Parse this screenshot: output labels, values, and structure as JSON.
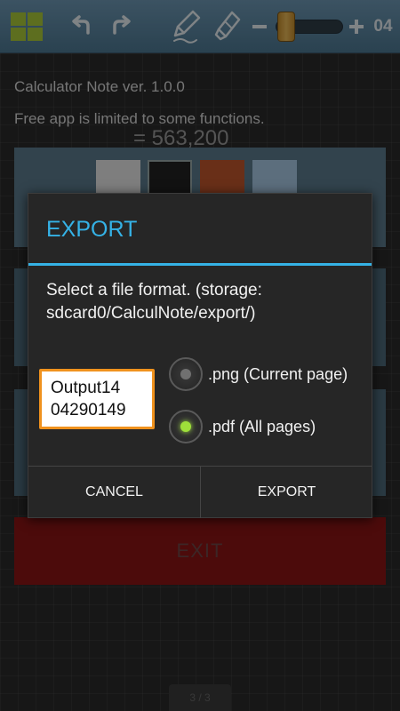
{
  "toolbar": {
    "icons": [
      "grid-menu-icon",
      "undo-icon",
      "redo-icon",
      "pen-icon",
      "eraser-icon",
      "minus-icon",
      "plus-icon"
    ],
    "pen_size": "04",
    "pen_size_slider_level": 0.05,
    "accent_color": "#a9c83a"
  },
  "background_screen": {
    "version_text": "Calculator Note ver. 1.0.0",
    "limit_text": "Free app is limited to some functions.",
    "calc_text": "= 563,200",
    "exit_label": "EXIT",
    "page_indicator": "3 / 3"
  },
  "dialog": {
    "title": "EXPORT",
    "message": "Select a file format. (storage: sdcard0/CalculNote/export/)",
    "filename_line1": "Output14",
    "filename_line2": "04290149",
    "options": [
      {
        "label": ".png (Current page)",
        "selected": false
      },
      {
        "label": ".pdf (All pages)",
        "selected": true
      }
    ],
    "cancel_label": "CANCEL",
    "export_label": "EXPORT",
    "accent_color": "#35b2e6"
  }
}
